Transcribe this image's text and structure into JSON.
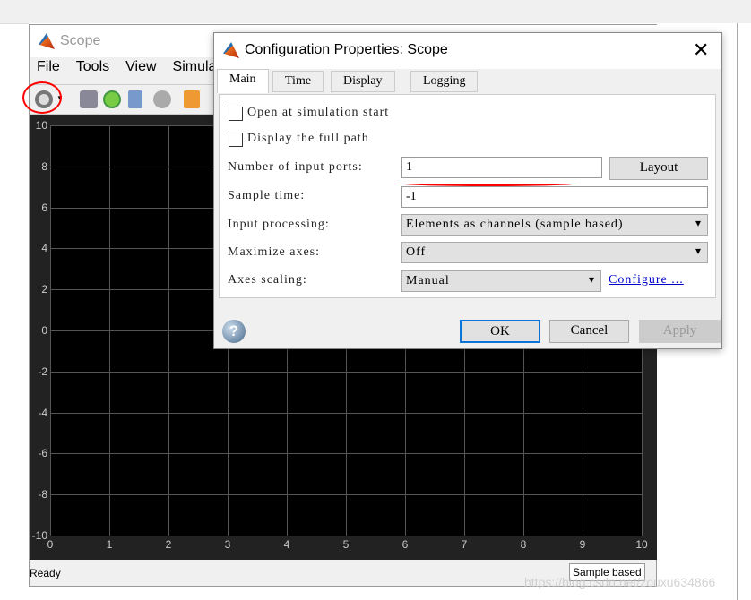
{
  "scope": {
    "title": "Scope",
    "menu": [
      "File",
      "Tools",
      "View",
      "Simula"
    ],
    "status_left": "Ready",
    "status_right": "Sample based"
  },
  "plot": {
    "yticks": [
      "10",
      "8",
      "6",
      "4",
      "2",
      "0",
      "-2",
      "-4",
      "-6",
      "-8",
      "-10"
    ],
    "xticks": [
      "0",
      "1",
      "2",
      "3",
      "4",
      "5",
      "6",
      "7",
      "8",
      "9",
      "10"
    ],
    "background": "#000000",
    "grid": true
  },
  "dialog": {
    "title": "Configuration Properties: Scope",
    "tabs": [
      "Main",
      "Time",
      "Display",
      "Logging"
    ],
    "open_at_start": "Open at simulation start",
    "display_full_path": "Display the full path",
    "input_ports_label": "Number of input ports:",
    "input_ports_value": "1",
    "layout_button": "Layout",
    "sample_time_label": "Sample time:",
    "sample_time_value": "-1",
    "input_processing_label": "Input processing:",
    "input_processing_value": "Elements as channels (sample based)",
    "maximize_axes_label": "Maximize axes:",
    "maximize_axes_value": "Off",
    "axes_scaling_label": "Axes scaling:",
    "axes_scaling_value": "Manual",
    "configure_link": "Configure ...",
    "ok": "OK",
    "cancel": "Cancel",
    "apply": "Apply"
  },
  "annotation_color": "#ff0000",
  "watermark": "https://blog.csdn.net/zouxu634866"
}
